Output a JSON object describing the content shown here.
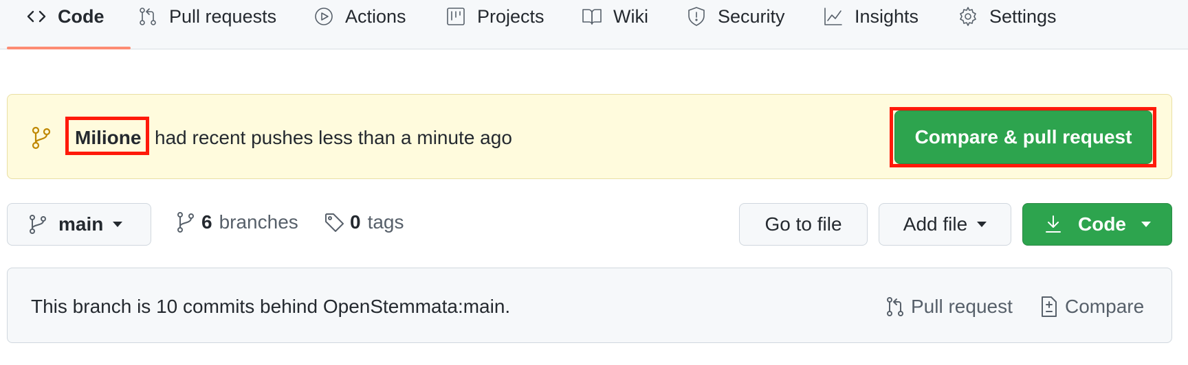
{
  "tabs": [
    {
      "label": "Code",
      "icon": "code-icon",
      "selected": true
    },
    {
      "label": "Pull requests",
      "icon": "git-pull-request-icon"
    },
    {
      "label": "Actions",
      "icon": "play-icon"
    },
    {
      "label": "Projects",
      "icon": "project-icon"
    },
    {
      "label": "Wiki",
      "icon": "book-icon"
    },
    {
      "label": "Security",
      "icon": "shield-icon"
    },
    {
      "label": "Insights",
      "icon": "graph-icon"
    },
    {
      "label": "Settings",
      "icon": "gear-icon"
    }
  ],
  "banner": {
    "branch_name": "Milione",
    "message": "had recent pushes less than a minute ago",
    "button_label": "Compare & pull request",
    "icon": "git-branch-icon"
  },
  "branch_bar": {
    "current_branch": "main",
    "branches_count": "6",
    "branches_label": "branches",
    "tags_count": "0",
    "tags_label": "tags",
    "go_to_file_label": "Go to file",
    "add_file_label": "Add file",
    "code_label": "Code"
  },
  "behind_notice": {
    "text": "This branch is 10 commits behind OpenStemmata:main.",
    "pull_request_label": "Pull request",
    "compare_label": "Compare"
  },
  "colors": {
    "green_button": "#2da44e",
    "banner_bg": "#fffbdd",
    "highlight_box": "#ff1a0a",
    "selected_tab_underline": "#fd8c73"
  }
}
